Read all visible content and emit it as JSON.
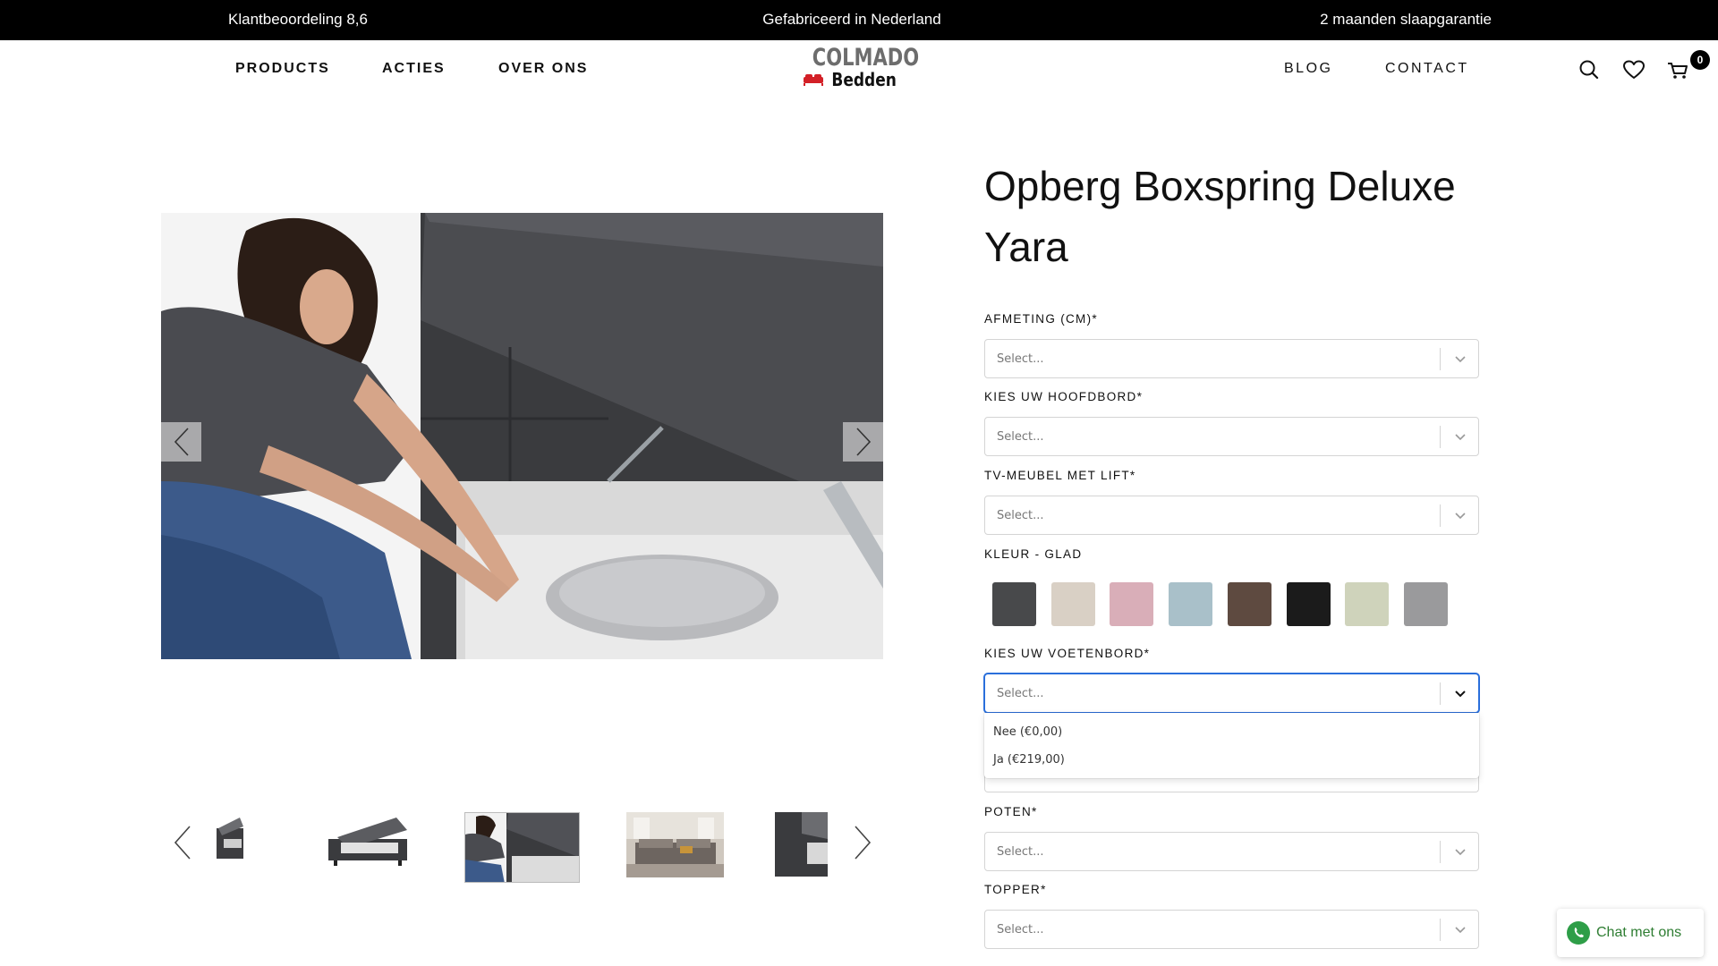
{
  "topbar": {
    "rating": "Klantbeoordeling 8,6",
    "made_in": "Gefabriceerd in Nederland",
    "guarantee": "2 maanden slaapgarantie"
  },
  "nav": {
    "left": [
      "PRODUCTS",
      "ACTIES",
      "OVER ONS"
    ],
    "right": [
      "BLOG",
      "CONTACT"
    ],
    "logo_top": "COLMADO",
    "logo_bottom": "Bedden",
    "cart_count": "0"
  },
  "icons": [
    "search-icon",
    "heart-icon",
    "cart-icon",
    "chevron-left-icon",
    "chevron-right-icon",
    "chevron-down-icon",
    "whatsapp-icon"
  ],
  "product": {
    "title_line1": "Opberg Boxspring Deluxe",
    "title_line2": "Yara"
  },
  "fields": [
    {
      "label": "AFMETING (CM)*",
      "placeholder": "Select..."
    },
    {
      "label": "KIES UW HOOFDBORD*",
      "placeholder": "Select..."
    },
    {
      "label": "TV-MEUBEL MET LIFT*",
      "placeholder": "Select..."
    },
    {
      "label": "KLEUR - GLAD"
    },
    {
      "label": "KIES UW VOETENBORD*",
      "placeholder": "Select..."
    },
    {
      "label": "POTEN*",
      "placeholder": "Select..."
    },
    {
      "label": "TOPPER*",
      "placeholder": "Select..."
    }
  ],
  "swatch_colors": [
    "#48494b",
    "#d9d0c5",
    "#d9aeb8",
    "#a9c0c9",
    "#5e4a40",
    "#1b1b1b",
    "#cfd3bb",
    "#9a9a9c"
  ],
  "dropdown_options": [
    "Nee (€0,00)",
    "Ja (€219,00)"
  ],
  "chat": {
    "label": "Chat met ons",
    "brand_color": "#2e7d32"
  }
}
